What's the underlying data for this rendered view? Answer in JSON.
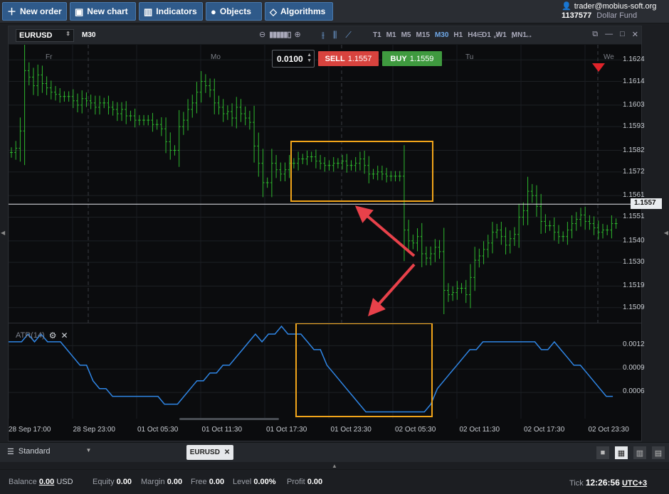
{
  "toolbar": {
    "buttons": [
      {
        "label": "New order",
        "icon": "plus-icon"
      },
      {
        "label": "New chart",
        "icon": "chart-window-icon"
      },
      {
        "label": "Indicators",
        "icon": "bar-chart-icon"
      },
      {
        "label": "Objects",
        "icon": "objects-icon"
      },
      {
        "label": "Algorithms",
        "icon": "algorithm-diamond-icon"
      }
    ]
  },
  "account": {
    "user": "trader@mobius-soft.org",
    "number": "1137577",
    "fund": "Dollar Fund"
  },
  "chart": {
    "symbol": "EURUSD",
    "timeframe": "M30",
    "timeframes": [
      "T1",
      "M1",
      "M5",
      "M15",
      "M30",
      "H1",
      "H4",
      "D1",
      "W1",
      "MN1"
    ],
    "active_timeframe": "M30",
    "lot": "0.0100",
    "sell_label": "SELL",
    "sell_price": "1.1557",
    "buy_label": "BUY",
    "buy_price": "1.1559",
    "current_price": "1.1557",
    "days": [
      "Fr",
      "Mo",
      "Tu",
      "We"
    ],
    "indicator_label": "ATR(14)",
    "colors": {
      "candles": "#2eb82e",
      "atr": "#2f86e6",
      "highlight": "#f2a51a",
      "arrow": "#e8414a",
      "sell": "#d8433e",
      "buy": "#3f9a3f"
    }
  },
  "chart_data": [
    {
      "type": "line",
      "title": "EURUSD",
      "ylabel": "",
      "yticks": [
        "1.1624",
        "1.1614",
        "1.1603",
        "1.1593",
        "1.1582",
        "1.1572",
        "1.1561",
        "1.1551",
        "1.1540",
        "1.1530",
        "1.1519",
        "1.1509"
      ],
      "ylim": [
        1.1502,
        1.1631
      ],
      "series": [
        {
          "values": [
            1.1581,
            1.1583,
            1.1591,
            1.1619,
            1.1616,
            1.1612,
            1.1617,
            1.1613,
            1.1611,
            1.1609,
            1.1608,
            1.1607,
            1.1607,
            1.1607,
            1.1605,
            1.1603,
            1.1606,
            1.1605,
            1.1604,
            1.1602,
            1.1604,
            1.1604,
            1.1602,
            1.1601,
            1.1599,
            1.1601,
            1.1598,
            1.1598,
            1.1596,
            1.1596,
            1.1596,
            1.1596,
            1.1594,
            1.1594,
            1.1592,
            1.1586,
            1.1582,
            1.1582,
            1.1593,
            1.1596,
            1.1601,
            1.1604,
            1.1609,
            1.1614,
            1.1612,
            1.161,
            1.1604,
            1.1602,
            1.1599,
            1.16,
            1.1597,
            1.1602,
            1.1599,
            1.1597,
            1.1595,
            1.1584,
            1.1576,
            1.1567,
            1.1567,
            1.1576,
            1.1573,
            1.1571,
            1.1573,
            1.1576,
            1.1576,
            1.1578,
            1.1578,
            1.1579,
            1.1579,
            1.1577,
            1.1576,
            1.1575,
            1.1575,
            1.1576,
            1.1576,
            1.1577,
            1.1575,
            1.1575,
            1.1576,
            1.1578,
            1.1575,
            1.1571,
            1.1571,
            1.1572,
            1.1571,
            1.157,
            1.157,
            1.157,
            1.157,
            1.1545,
            1.154,
            1.1539,
            1.1542,
            1.1534,
            1.1532,
            1.1534,
            1.1537,
            1.1535,
            1.1517,
            1.1515,
            1.1516,
            1.1518,
            1.1518,
            1.1515,
            1.1523,
            1.1531,
            1.1533,
            1.1536,
            1.1539,
            1.1544,
            1.1545,
            1.1542,
            1.1538,
            1.1541,
            1.1543,
            1.1551,
            1.1554,
            1.1563,
            1.1561,
            1.1556,
            1.1549,
            1.1547,
            1.1547,
            1.1544,
            1.1542,
            1.1542,
            1.1545,
            1.1548,
            1.155,
            1.1552,
            1.1549,
            1.1548,
            1.1546,
            1.1544,
            1.1545,
            1.1545,
            1.1548,
            1.1548
          ]
        }
      ],
      "notes_visible": [
        "Fr",
        "Mo",
        "Tu",
        "We"
      ]
    },
    {
      "type": "line",
      "title": "ATR(14)",
      "yticks": [
        "0.0012",
        "0.0009",
        "0.0006"
      ],
      "ylim": [
        0.0003,
        0.00145
      ],
      "series": [
        {
          "name": "ATR(14)",
          "values": [
            0.00125,
            0.00125,
            0.00125,
            0.00135,
            0.00125,
            0.00135,
            0.00125,
            0.00125,
            0.00125,
            0.00115,
            0.00105,
            0.00095,
            0.00095,
            0.00075,
            0.00065,
            0.00065,
            0.00055,
            0.00055,
            0.00055,
            0.00055,
            0.00055,
            0.00055,
            0.00055,
            0.00055,
            0.00045,
            0.00045,
            0.00045,
            0.00055,
            0.00065,
            0.00075,
            0.00075,
            0.00085,
            0.00085,
            0.00095,
            0.00095,
            0.00105,
            0.00115,
            0.00125,
            0.00135,
            0.00125,
            0.00135,
            0.00135,
            0.00145,
            0.00135,
            0.00135,
            0.00135,
            0.00125,
            0.00115,
            0.00115,
            0.00095,
            0.00085,
            0.00075,
            0.00065,
            0.00055,
            0.00045,
            0.00035,
            0.00035,
            0.00035,
            0.00035,
            0.00035,
            0.00035,
            0.00035,
            0.00035,
            0.00035,
            0.00035,
            0.00045,
            0.00065,
            0.00075,
            0.00085,
            0.00095,
            0.00105,
            0.00115,
            0.00115,
            0.00125,
            0.00125,
            0.00125,
            0.00125,
            0.00125,
            0.00125,
            0.00125,
            0.00125,
            0.00125,
            0.00115,
            0.00115,
            0.00125,
            0.00115,
            0.00105,
            0.00095,
            0.00095,
            0.00085,
            0.00075,
            0.00065,
            0.00055,
            0.00055
          ]
        }
      ]
    }
  ],
  "xaxis": [
    "28 Sep 17:00",
    "28 Sep 23:00",
    "01 Oct 05:30",
    "01 Oct 11:30",
    "01 Oct 17:30",
    "01 Oct 23:30",
    "02 Oct 05:30",
    "02 Oct 11:30",
    "02 Oct 17:30",
    "02 Oct 23:30"
  ],
  "tabs": {
    "workspace": "Standard",
    "chart_tab": "EURUSD"
  },
  "status": {
    "balance_label": "Balance",
    "balance": "0.00",
    "currency": "USD",
    "equity_label": "Equity",
    "equity": "0.00",
    "margin_label": "Margin",
    "margin": "0.00",
    "free_label": "Free",
    "free": "0.00",
    "level_label": "Level",
    "level": "0.00%",
    "profit_label": "Profit",
    "profit": "0.00",
    "tick_label": "Tick",
    "time": "12:26:56",
    "tz": "UTC+3"
  }
}
